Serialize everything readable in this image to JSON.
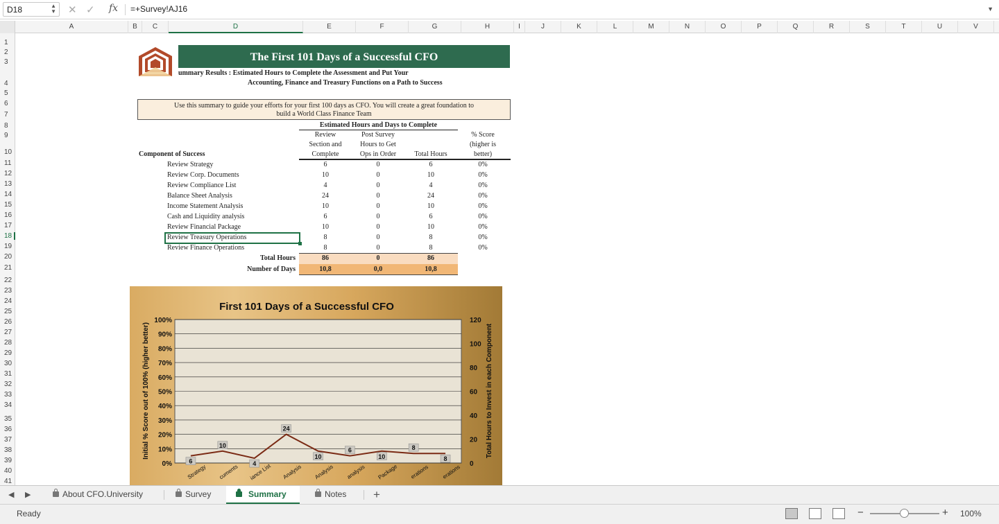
{
  "formula_bar": {
    "cell_ref": "D18",
    "formula": "=+Survey!AJ16"
  },
  "columns": [
    "A",
    "B",
    "C",
    "D",
    "E",
    "F",
    "G",
    "H",
    "I",
    "J",
    "K",
    "L",
    "M",
    "N",
    "O",
    "P",
    "Q",
    "R",
    "S",
    "T",
    "U",
    "V"
  ],
  "rows": [
    "1",
    "2",
    "3",
    "4",
    "5",
    "6",
    "7",
    "8",
    "9",
    "10",
    "11",
    "12",
    "13",
    "14",
    "15",
    "16",
    "17",
    "18",
    "19",
    "20",
    "21",
    "22",
    "23",
    "24",
    "25",
    "26",
    "27",
    "28",
    "29",
    "30",
    "31",
    "32",
    "33",
    "34",
    "35",
    "36",
    "37",
    "38",
    "39",
    "40",
    "41"
  ],
  "selected": {
    "column": "D",
    "row": "18"
  },
  "sheet": {
    "title": "The First 101 Days of a Successful CFO",
    "subtitle_line1": "ummary Results :  Estimated Hours to Complete the Assessment and Put Your",
    "subtitle_line2": "Accounting, Finance and Treasury Functions on a Path to Success",
    "note_line1": "Use this summary to guide your efforts for your first 100 days as CFO.  You will create a great foundation to",
    "note_line2": "build a World Class Finance Team",
    "estimated_header": "Estimated Hours and Days to Complete",
    "col_review": [
      "Review",
      "Section and",
      "Complete"
    ],
    "col_post": [
      "Post Survey",
      "Hours to Get",
      "Ops in Order"
    ],
    "col_total": "Total Hours",
    "col_score": [
      "% Score",
      "(higher is",
      "better)"
    ],
    "component_header": "Component of Success",
    "components": [
      {
        "name": "Review Strategy",
        "review": "6",
        "post": "0",
        "total": "6",
        "score": "0%"
      },
      {
        "name": "Review Corp. Documents",
        "review": "10",
        "post": "0",
        "total": "10",
        "score": "0%"
      },
      {
        "name": "Review Compliance List",
        "review": "4",
        "post": "0",
        "total": "4",
        "score": "0%"
      },
      {
        "name": "Balance Sheet Analysis",
        "review": "24",
        "post": "0",
        "total": "24",
        "score": "0%"
      },
      {
        "name": "Income Statement Analysis",
        "review": "10",
        "post": "0",
        "total": "10",
        "score": "0%"
      },
      {
        "name": "Cash and Liquidity analysis",
        "review": "6",
        "post": "0",
        "total": "6",
        "score": "0%"
      },
      {
        "name": "Review Financial Package",
        "review": "10",
        "post": "0",
        "total": "10",
        "score": "0%"
      },
      {
        "name": "Review Treasury Operations",
        "review": "8",
        "post": "0",
        "total": "8",
        "score": "0%"
      },
      {
        "name": "Review Finance Operations",
        "review": "8",
        "post": "0",
        "total": "8",
        "score": "0%"
      }
    ],
    "total_label": "Total Hours",
    "totals": {
      "review": "86",
      "post": "0",
      "total": "86"
    },
    "days_label": "Number of Days",
    "days": {
      "review": "10,8",
      "post": "0,0",
      "total": "10,8"
    }
  },
  "chart_data": {
    "type": "line",
    "title": "First 101 Days of a Successful CFO",
    "ylabel_left": "Initial % Score out of 100% (higher better)",
    "ylabel_right": "Total Hours to Invest in each Component",
    "left_ticks": [
      "100%",
      "90%",
      "80%",
      "70%",
      "60%",
      "50%",
      "40%",
      "30%",
      "20%",
      "10%",
      "0%"
    ],
    "right_ticks": [
      "120",
      "100",
      "80",
      "60",
      "40",
      "20",
      "0"
    ],
    "ylim_left": [
      0,
      1
    ],
    "ylim_right": [
      0,
      120
    ],
    "categories": [
      "Strategy",
      "cuments",
      "iance List",
      "Analysis",
      "Analysis",
      "analysis",
      "Package",
      "erations",
      "erations"
    ],
    "series": [
      {
        "values": [
          6,
          10,
          4,
          24,
          10,
          6,
          10,
          8,
          8
        ],
        "color": "#7a2a14"
      }
    ],
    "grid": "horizontal",
    "plot_fill": "#e9e3d5"
  },
  "tabs": [
    {
      "label": "About CFO.University",
      "active": false
    },
    {
      "label": "Survey",
      "active": false
    },
    {
      "label": "Summary",
      "active": true
    },
    {
      "label": "Notes",
      "active": false
    }
  ],
  "status": {
    "ready": "Ready",
    "zoom": "100%"
  }
}
